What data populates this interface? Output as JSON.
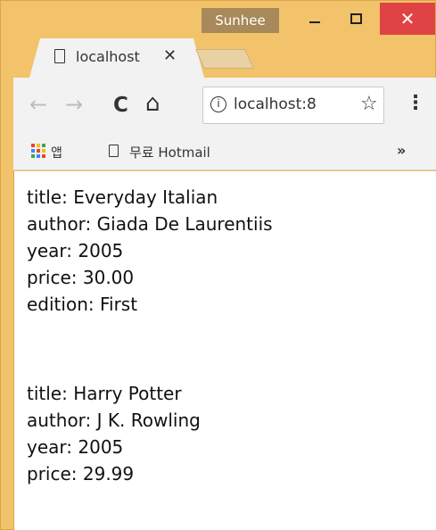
{
  "window": {
    "user_badge": "Sunhee",
    "min_icon": "minimize-icon",
    "max_icon": "maximize-icon",
    "close_glyph": "✕"
  },
  "tab": {
    "title": "localhost",
    "close_glyph": "✕"
  },
  "toolbar": {
    "back_glyph": "←",
    "forward_glyph": "→",
    "reload_glyph": "C",
    "home_glyph": "⌂",
    "info_glyph": "i",
    "url": "localhost:8",
    "star_glyph": "☆",
    "menu_glyph": "⋮"
  },
  "bookmarks": {
    "apps_label": "앱",
    "item_label": "무료 Hotmail",
    "more_glyph": "»",
    "apps_colors": [
      "#ea4335",
      "#fbbc05",
      "#34a853",
      "#4285f4",
      "#ea4335",
      "#fbbc05",
      "#34a853",
      "#4285f4",
      "#ea4335"
    ]
  },
  "books": [
    {
      "title": "title: Everyday Italian",
      "author": "author: Giada De Laurentiis",
      "year": "year: 2005",
      "price": "price: 30.00",
      "edition": "edition: First"
    },
    {
      "title": "title: Harry Potter",
      "author": "author: J K. Rowling",
      "year": "year: 2005",
      "price": "price: 29.99"
    }
  ]
}
